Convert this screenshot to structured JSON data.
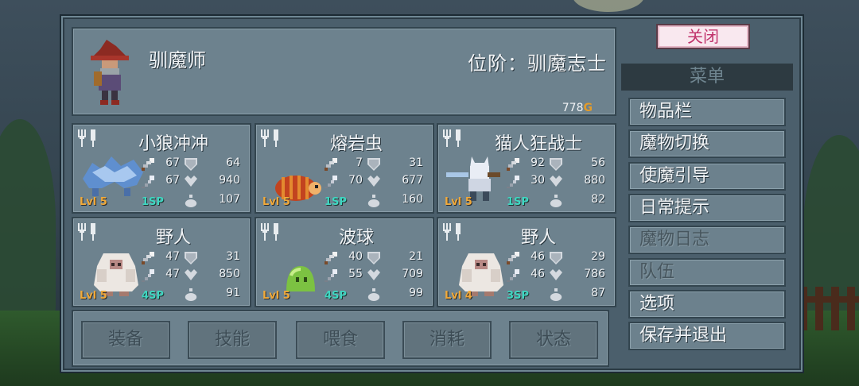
{
  "hero": {
    "name": "驯魔师",
    "rank": "位阶：驯魔志士",
    "gold_value": "778",
    "gold_unit": "G"
  },
  "monsters": [
    {
      "name": "小狼冲冲",
      "level": "Lvl 5",
      "sp": "1SP",
      "attack": "67",
      "magic": "67",
      "defense": "64",
      "hp": "940",
      "mana": "107",
      "sprite": "wolf"
    },
    {
      "name": "熔岩虫",
      "level": "Lvl 5",
      "sp": "1SP",
      "attack": "7",
      "magic": "70",
      "defense": "31",
      "hp": "677",
      "mana": "160",
      "sprite": "worm"
    },
    {
      "name": "猫人狂战士",
      "level": "Lvl 5",
      "sp": "1SP",
      "attack": "92",
      "magic": "30",
      "defense": "56",
      "hp": "880",
      "mana": "82",
      "sprite": "cat"
    },
    {
      "name": "野人",
      "level": "Lvl 5",
      "sp": "4SP",
      "attack": "47",
      "magic": "47",
      "defense": "31",
      "hp": "850",
      "mana": "91",
      "sprite": "yeti"
    },
    {
      "name": "波球",
      "level": "Lvl 5",
      "sp": "4SP",
      "attack": "40",
      "magic": "55",
      "defense": "21",
      "hp": "709",
      "mana": "99",
      "sprite": "slime"
    },
    {
      "name": "野人",
      "level": "Lvl 4",
      "sp": "3SP",
      "attack": "46",
      "magic": "46",
      "defense": "29",
      "hp": "786",
      "mana": "87",
      "sprite": "yeti"
    }
  ],
  "tabs": [
    "装备",
    "技能",
    "喂食",
    "消耗",
    "状态"
  ],
  "menu": {
    "close_label": "关闭",
    "title": "菜单",
    "items": [
      {
        "label": "物品栏",
        "enabled": true
      },
      {
        "label": "魔物切换",
        "enabled": true
      },
      {
        "label": "使魔引导",
        "enabled": true
      },
      {
        "label": "日常提示",
        "enabled": true
      },
      {
        "label": "魔物日志",
        "enabled": false
      },
      {
        "label": "队伍",
        "enabled": false
      },
      {
        "label": "选项",
        "enabled": true
      },
      {
        "label": "保存并退出",
        "enabled": true
      }
    ]
  },
  "colors": {
    "level": "#f0a93a",
    "sp": "#3fd6c1",
    "close_text": "#c0336b",
    "gold": "#e29b2b"
  }
}
